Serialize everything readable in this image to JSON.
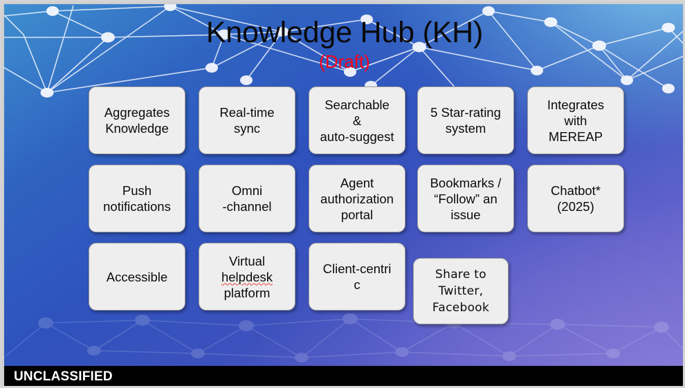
{
  "slide": {
    "title": "Knowledge Hub (KH)",
    "subtitle": "(Draft)",
    "title_color": "#000000",
    "subtitle_color": "#FD0018",
    "background_colors": {
      "top_light_blue": "#76BEE8",
      "mid_blue": "#2F52BD",
      "bottom_purple": "#7B72D4"
    }
  },
  "features": {
    "row1": [
      {
        "label": "Aggregates\nKnowledge"
      },
      {
        "label": "Real-time\nsync"
      },
      {
        "label": "Searchable\n&\nauto-suggest"
      },
      {
        "label": "5 Star-rating\nsystem"
      },
      {
        "label": "Integrates\nwith\nMEREAP"
      }
    ],
    "row2": [
      {
        "label": "Push\nnotifications"
      },
      {
        "label": "Omni\n-channel"
      },
      {
        "label": "Agent\nauthorization\nportal"
      },
      {
        "label": "Bookmarks /\n“Follow” an\nissue"
      },
      {
        "label": "Chatbot*\n(2025)"
      }
    ],
    "row3": [
      {
        "label": "Accessible"
      },
      {
        "label_line1": "Virtual",
        "label_line2": "helpdesk",
        "label_line3": "platform"
      },
      {
        "label": "Client-centri\nc"
      },
      {
        "label": "Share to\nTwitter,\nFacebook"
      }
    ]
  },
  "footer": {
    "classification": "UNCLASSIFIED",
    "bar_color": "#000000",
    "text_color": "#FFFFFF"
  }
}
